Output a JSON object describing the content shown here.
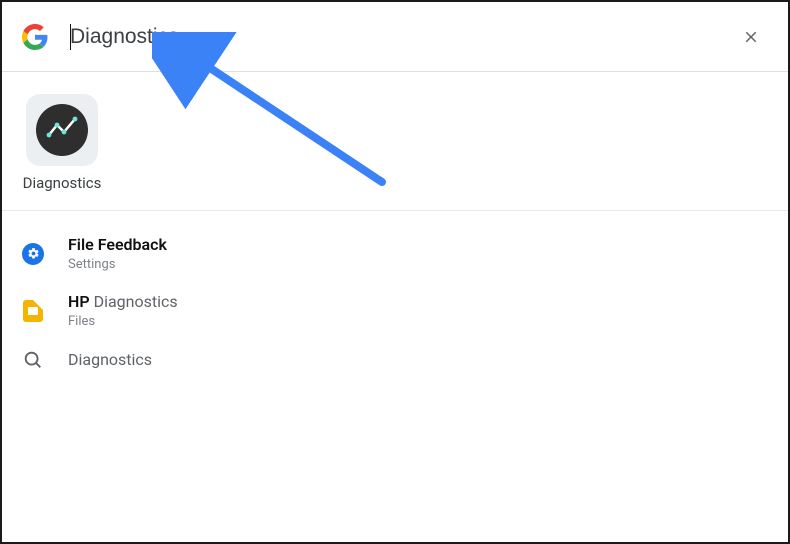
{
  "search": {
    "query": "Diagnostics",
    "close_label": "Close"
  },
  "app_result": {
    "label": "Diagnostics"
  },
  "results": [
    {
      "icon": "settings-icon",
      "title_prefix": "",
      "title_match": "File Feedback",
      "title_suffix": "",
      "subtitle": "Settings"
    },
    {
      "icon": "slides-file-icon",
      "title_prefix": "HP ",
      "title_match": "",
      "title_suffix": "Diagnostics",
      "subtitle": "Files"
    },
    {
      "icon": "search-icon",
      "title_prefix": "",
      "title_match": "",
      "title_suffix": "Diagnostics",
      "subtitle": ""
    }
  ],
  "annotation": {
    "arrow_color": "#3b82f6"
  }
}
